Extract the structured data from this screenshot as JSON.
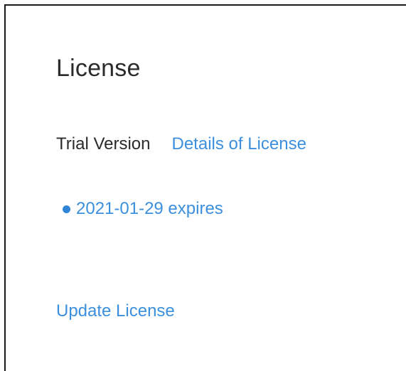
{
  "panel": {
    "title": "License",
    "version_label": "Trial Version",
    "details_link": "Details of License",
    "expiry_text": "2021-01-29 expires",
    "update_link": "Update License"
  },
  "colors": {
    "link": "#3c8fdd",
    "status_dot": "#2f86d8",
    "text": "#2b2b2b",
    "border": "#1a1a1a"
  },
  "icons": {
    "status": "status-dot-icon"
  }
}
